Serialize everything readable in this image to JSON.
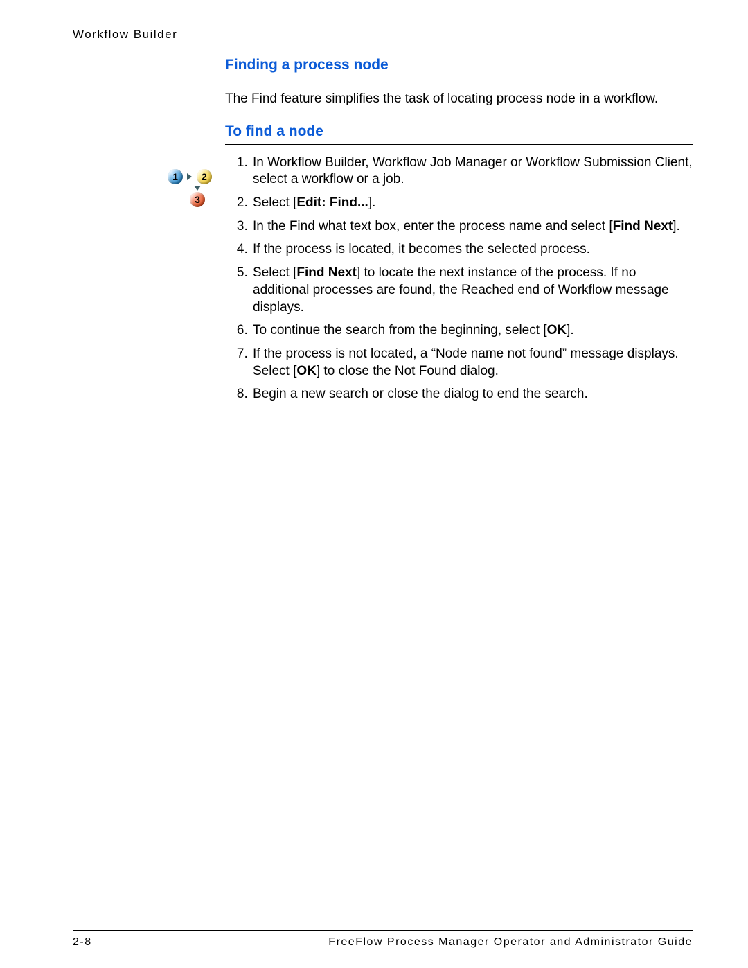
{
  "header": {
    "section": "Workflow Builder"
  },
  "section1": {
    "heading": "Finding a process node",
    "intro": "The Find feature simplifies the task of locating process node in a workflow."
  },
  "section2": {
    "heading": "To find a node",
    "steps": {
      "s1": "In Workflow Builder, Workflow Job Manager or Workflow Submission Client, select a workflow or a job.",
      "s2_pre": "Select [",
      "s2_bold": "Edit: Find...",
      "s2_post": "].",
      "s3_pre": "In the Find what text box, enter the process name and select [",
      "s3_bold": "Find Next",
      "s3_post": "].",
      "s4": "If the process is located, it becomes the selected process.",
      "s5_pre": "Select [",
      "s5_bold": "Find Next",
      "s5_post": "] to locate the next instance of the process. If no additional processes are found, the Reached end of Workflow message displays.",
      "s6_pre": "To continue the search from the beginning, select [",
      "s6_bold": "OK",
      "s6_post": "].",
      "s7_pre": "If the process is not located, a “Node name not found” message displays. Select [",
      "s7_bold": "OK",
      "s7_post": "] to close the Not Found dialog.",
      "s8": "Begin a new search or close the dialog to end the search."
    }
  },
  "icons": {
    "b1": "1",
    "b2": "2",
    "b3": "3"
  },
  "footer": {
    "page": "2-8",
    "doc": "FreeFlow Process Manager Operator and Administrator Guide"
  }
}
